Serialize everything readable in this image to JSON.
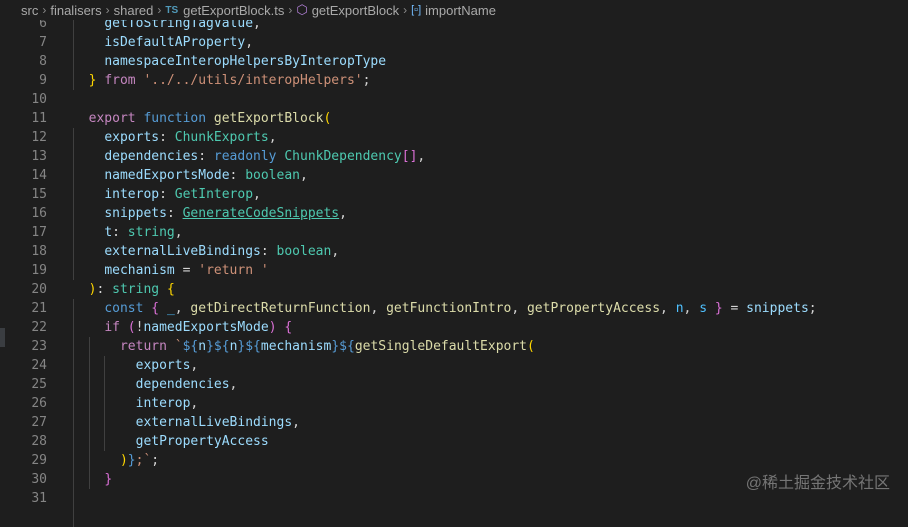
{
  "breadcrumb": {
    "items": [
      "src",
      "finalisers",
      "shared",
      "getExportBlock.ts",
      "getExportBlock",
      "importName"
    ],
    "ts_icon": "TS",
    "icons": [
      "ts-file-icon",
      "method-cube-icon",
      "variable-icon"
    ]
  },
  "colors": {
    "background": "#1e1e1e",
    "keyword": "#c586c0",
    "storage": "#569cd6",
    "function": "#dcdcaa",
    "variable": "#9cdcfe",
    "type": "#4ec9b0",
    "string": "#ce9178",
    "bracket_gold": "#ffd700",
    "bracket_purple": "#da70d6",
    "bracket_blue": "#179fff",
    "linenumber": "#858585"
  },
  "lines": [
    {
      "n": "6",
      "tokens": [
        [
          "    ",
          "p"
        ],
        [
          "getToStringTagValue",
          "v"
        ],
        [
          ",",
          "p"
        ]
      ]
    },
    {
      "n": "7",
      "tokens": [
        [
          "    ",
          "p"
        ],
        [
          "isDefaultAProperty",
          "v"
        ],
        [
          ",",
          "p"
        ]
      ]
    },
    {
      "n": "8",
      "tokens": [
        [
          "    ",
          "p"
        ],
        [
          "namespaceInteropHelpersByInteropType",
          "v"
        ]
      ]
    },
    {
      "n": "9",
      "tokens": [
        [
          "  ",
          "p"
        ],
        [
          "}",
          "b1"
        ],
        [
          " ",
          "p"
        ],
        [
          "from",
          "k"
        ],
        [
          " ",
          "p"
        ],
        [
          "'../../utils/interopHelpers'",
          "s"
        ],
        [
          ";",
          "p"
        ]
      ]
    },
    {
      "n": "10",
      "tokens": []
    },
    {
      "n": "11",
      "tokens": [
        [
          "  ",
          "p"
        ],
        [
          "export",
          "k"
        ],
        [
          " ",
          "p"
        ],
        [
          "function",
          "st"
        ],
        [
          " ",
          "p"
        ],
        [
          "getExportBlock",
          "f"
        ],
        [
          "(",
          "b1"
        ]
      ]
    },
    {
      "n": "12",
      "tokens": [
        [
          "    ",
          "p"
        ],
        [
          "exports",
          "v"
        ],
        [
          ": ",
          "p"
        ],
        [
          "ChunkExports",
          "t"
        ],
        [
          ",",
          "p"
        ]
      ]
    },
    {
      "n": "13",
      "tokens": [
        [
          "    ",
          "p"
        ],
        [
          "dependencies",
          "v"
        ],
        [
          ": ",
          "p"
        ],
        [
          "readonly",
          "st"
        ],
        [
          " ",
          "p"
        ],
        [
          "ChunkDependency",
          "t"
        ],
        [
          "[]",
          "b2"
        ],
        [
          ",",
          "p"
        ]
      ]
    },
    {
      "n": "14",
      "tokens": [
        [
          "    ",
          "p"
        ],
        [
          "namedExportsMode",
          "v"
        ],
        [
          ": ",
          "p"
        ],
        [
          "boolean",
          "t"
        ],
        [
          ",",
          "p"
        ]
      ]
    },
    {
      "n": "15",
      "tokens": [
        [
          "    ",
          "p"
        ],
        [
          "interop",
          "v"
        ],
        [
          ": ",
          "p"
        ],
        [
          "GetInterop",
          "t"
        ],
        [
          ",",
          "p"
        ]
      ]
    },
    {
      "n": "16",
      "tokens": [
        [
          "    ",
          "p"
        ],
        [
          "snippets",
          "v"
        ],
        [
          ": ",
          "p"
        ],
        [
          "GenerateCodeSnippets",
          "tu"
        ],
        [
          ",",
          "p"
        ]
      ]
    },
    {
      "n": "17",
      "tokens": [
        [
          "    ",
          "p"
        ],
        [
          "t",
          "v"
        ],
        [
          ": ",
          "p"
        ],
        [
          "string",
          "t"
        ],
        [
          ",",
          "p"
        ]
      ]
    },
    {
      "n": "18",
      "tokens": [
        [
          "    ",
          "p"
        ],
        [
          "externalLiveBindings",
          "v"
        ],
        [
          ": ",
          "p"
        ],
        [
          "boolean",
          "t"
        ],
        [
          ",",
          "p"
        ]
      ]
    },
    {
      "n": "19",
      "tokens": [
        [
          "    ",
          "p"
        ],
        [
          "mechanism",
          "v"
        ],
        [
          " = ",
          "p"
        ],
        [
          "'return '",
          "s"
        ]
      ]
    },
    {
      "n": "20",
      "tokens": [
        [
          "  ",
          "p"
        ],
        [
          ")",
          "b1"
        ],
        [
          ": ",
          "p"
        ],
        [
          "string",
          "t"
        ],
        [
          " ",
          "p"
        ],
        [
          "{",
          "b1"
        ]
      ]
    },
    {
      "n": "21",
      "tokens": [
        [
          "    ",
          "p"
        ],
        [
          "const",
          "st"
        ],
        [
          " ",
          "p"
        ],
        [
          "{",
          "b2"
        ],
        [
          " ",
          "p"
        ],
        [
          "_",
          "cv"
        ],
        [
          ", ",
          "p"
        ],
        [
          "getDirectReturnFunction",
          "f"
        ],
        [
          ", ",
          "p"
        ],
        [
          "getFunctionIntro",
          "f"
        ],
        [
          ", ",
          "p"
        ],
        [
          "getPropertyAccess",
          "f"
        ],
        [
          ", ",
          "p"
        ],
        [
          "n",
          "cv"
        ],
        [
          ", ",
          "p"
        ],
        [
          "s",
          "cv"
        ],
        [
          " ",
          "p"
        ],
        [
          "}",
          "b2"
        ],
        [
          " = ",
          "p"
        ],
        [
          "snippets",
          "v"
        ],
        [
          ";",
          "p"
        ]
      ]
    },
    {
      "n": "22",
      "tokens": [
        [
          "    ",
          "p"
        ],
        [
          "if",
          "k"
        ],
        [
          " ",
          "p"
        ],
        [
          "(",
          "b2"
        ],
        [
          "!",
          "p"
        ],
        [
          "namedExportsMode",
          "v"
        ],
        [
          ")",
          "b2"
        ],
        [
          " ",
          "p"
        ],
        [
          "{",
          "b2"
        ]
      ]
    },
    {
      "n": "23",
      "tokens": [
        [
          "      ",
          "p"
        ],
        [
          "return",
          "k"
        ],
        [
          " ",
          "p"
        ],
        [
          "`",
          "s"
        ],
        [
          "${",
          "st"
        ],
        [
          "n",
          "v"
        ],
        [
          "}",
          "st"
        ],
        [
          "${",
          "st"
        ],
        [
          "n",
          "v"
        ],
        [
          "}",
          "st"
        ],
        [
          "${",
          "st"
        ],
        [
          "mechanism",
          "v"
        ],
        [
          "}",
          "st"
        ],
        [
          "${",
          "st"
        ],
        [
          "getSingleDefaultExport",
          "f"
        ],
        [
          "(",
          "b1"
        ]
      ]
    },
    {
      "n": "24",
      "tokens": [
        [
          "        ",
          "p"
        ],
        [
          "exports",
          "v"
        ],
        [
          ",",
          "p"
        ]
      ]
    },
    {
      "n": "25",
      "tokens": [
        [
          "        ",
          "p"
        ],
        [
          "dependencies",
          "v"
        ],
        [
          ",",
          "p"
        ]
      ]
    },
    {
      "n": "26",
      "tokens": [
        [
          "        ",
          "p"
        ],
        [
          "interop",
          "v"
        ],
        [
          ",",
          "p"
        ]
      ]
    },
    {
      "n": "27",
      "tokens": [
        [
          "        ",
          "p"
        ],
        [
          "externalLiveBindings",
          "v"
        ],
        [
          ",",
          "p"
        ]
      ]
    },
    {
      "n": "28",
      "tokens": [
        [
          "        ",
          "p"
        ],
        [
          "getPropertyAccess",
          "v"
        ]
      ]
    },
    {
      "n": "29",
      "tokens": [
        [
          "      ",
          "p"
        ],
        [
          ")",
          "b1"
        ],
        [
          "}",
          "st"
        ],
        [
          ";",
          "s"
        ],
        [
          "`",
          "s"
        ],
        [
          ";",
          "p"
        ]
      ]
    },
    {
      "n": "30",
      "tokens": [
        [
          "    ",
          "p"
        ],
        [
          "}",
          "b2"
        ]
      ]
    },
    {
      "n": "31",
      "tokens": []
    }
  ],
  "watermark": "@稀土掘金技术社区"
}
